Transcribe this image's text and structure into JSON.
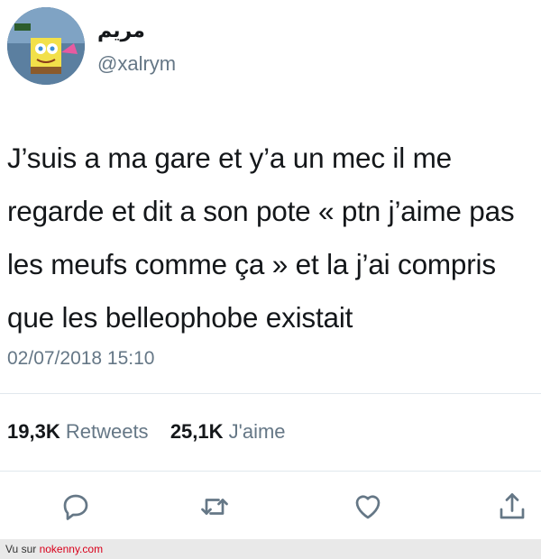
{
  "user": {
    "display_name": "مريم",
    "handle": "@xalrym",
    "avatar_icon": "spongebob-avatar-icon"
  },
  "tweet": {
    "text": "J’suis a ma gare et y’a un mec il me regarde et dit a son pote « ptn j’aime pas les meufs comme ça » et la j’ai compris que les belleophobe existait",
    "timestamp": "02/07/2018 15:10"
  },
  "stats": {
    "retweets_count": "19,3K",
    "retweets_label": "Retweets",
    "likes_count": "25,1K",
    "likes_label": "J'aime"
  },
  "actions": [
    "reply-icon",
    "retweet-icon",
    "like-icon",
    "share-icon"
  ],
  "footer": {
    "prefix": "Vu sur ",
    "site": "nokenny.com"
  },
  "colors": {
    "text": "#14171a",
    "secondary": "#657786",
    "divider": "#e1e8ed",
    "footer_link": "#d9001b"
  }
}
